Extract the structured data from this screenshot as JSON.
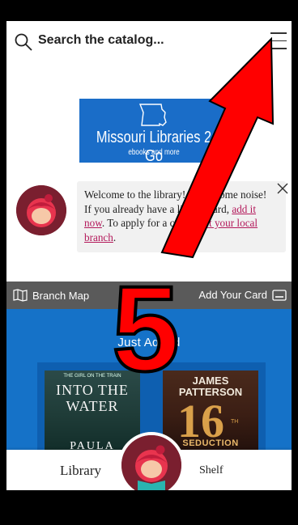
{
  "search": {
    "label": "Search the catalog..."
  },
  "logo": {
    "title": "Missouri Libraries 2 Go",
    "subtitle": "ebooks and more"
  },
  "welcome": {
    "text_1": "Welcome to the library! Make some noise! If you already have a library card, ",
    "link_add": "add it now",
    "text_2": ". To apply for a card, ",
    "link_visit": "visit your local branch",
    "text_3": "."
  },
  "toolbar": {
    "branch_map": "Branch Map",
    "add_card": "Add Your Card"
  },
  "section": {
    "title": "Just Added"
  },
  "books": [
    {
      "top_line": "THE GIRL ON THE TRAIN",
      "title": "INTO THE WATER",
      "author": "PAULA"
    },
    {
      "author": "JAMES PATTERSON",
      "number": "16",
      "number_suffix": "TH",
      "subtitle": "SEDUCTION"
    }
  ],
  "nav": {
    "library": "Library",
    "shelf": "Shelf"
  },
  "annotation": {
    "number": "5"
  },
  "colors": {
    "brand_blue": "#1572c8",
    "avatar_maroon": "#7a1f2f",
    "link": "#b3185a",
    "arrow_red": "#ff0000"
  }
}
